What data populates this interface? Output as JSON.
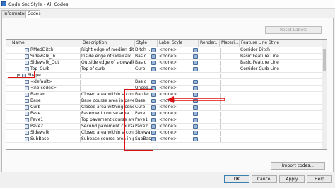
{
  "window": {
    "title": "Code Set Style - All Codes"
  },
  "tabs": [
    {
      "label": "Informaton"
    },
    {
      "label": "Codes"
    }
  ],
  "toolbar": {
    "reset_labels": "Reset Labels"
  },
  "columns": {
    "name": "Name",
    "description": "Description",
    "style": "Style",
    "label_style": "Label Style",
    "render": "Render...",
    "material": "Materi...",
    "feature_line_style": "Feature Line Style"
  },
  "rows": [
    {
      "name": "RMedDitch",
      "description": "Right edge of median ditch",
      "style": "Ditch ...",
      "label_style": "<none>",
      "feature_line_style": "Corridor Ditch"
    },
    {
      "name": "Sidewalk_In",
      "description": "Inside edge of sidewalk",
      "style": "Basic",
      "label_style": "<none>",
      "feature_line_style": "Basic Feature Line"
    },
    {
      "name": "Sidewalk_Out",
      "description": "Outside edge of sidewalk",
      "style": "Basic",
      "label_style": "<none>",
      "feature_line_style": "Basic Feature Line"
    },
    {
      "name": "Top_Curb",
      "description": "Top of curb",
      "style": "Curb",
      "label_style": "<none>",
      "feature_line_style": "Corridor Curb Line"
    },
    {
      "name": "Shape",
      "description": "",
      "style": "",
      "label_style": "",
      "feature_line_style": ""
    },
    {
      "name": "<default>",
      "description": "",
      "style": "Basic",
      "label_style": "<none>",
      "feature_line_style": ""
    },
    {
      "name": "<no codes>",
      "description": "",
      "style": "Uncod...",
      "label_style": "<none>",
      "feature_line_style": ""
    },
    {
      "name": "Barrier",
      "description": "Closed area within a concr...",
      "style": "Barrier",
      "label_style": "<none>",
      "feature_line_style": ""
    },
    {
      "name": "Base",
      "description": "Base course area in paved s...",
      "style": "Base",
      "label_style": "<none>",
      "feature_line_style": ""
    },
    {
      "name": "Curb",
      "description": "Closed area withing concre...",
      "style": "Curb",
      "label_style": "<none>",
      "feature_line_style": ""
    },
    {
      "name": "Pave",
      "description": "Pavement course area",
      "style": "Pave",
      "label_style": "<none>",
      "feature_line_style": ""
    },
    {
      "name": "Pave1",
      "description": "Top pavement course area",
      "style": "Pave1",
      "label_style": "<none>",
      "feature_line_style": ""
    },
    {
      "name": "Pave2",
      "description": "Second pavement course are...",
      "style": "Pave2",
      "label_style": "<none>",
      "feature_line_style": ""
    },
    {
      "name": "Sidewalk",
      "description": "Closed area within a concre...",
      "style": "Sidewalk",
      "label_style": "<none>",
      "feature_line_style": ""
    },
    {
      "name": "SubBase",
      "description": "Subbase course area in pav...",
      "style": "SubBase",
      "label_style": "<none>",
      "feature_line_style": ""
    }
  ],
  "buttons": {
    "import_codes": "Import codes...",
    "ok": "OK",
    "cancel": "Cancel",
    "apply": "Apply",
    "help": "Help"
  },
  "colors": {
    "highlight": "#e01010"
  }
}
